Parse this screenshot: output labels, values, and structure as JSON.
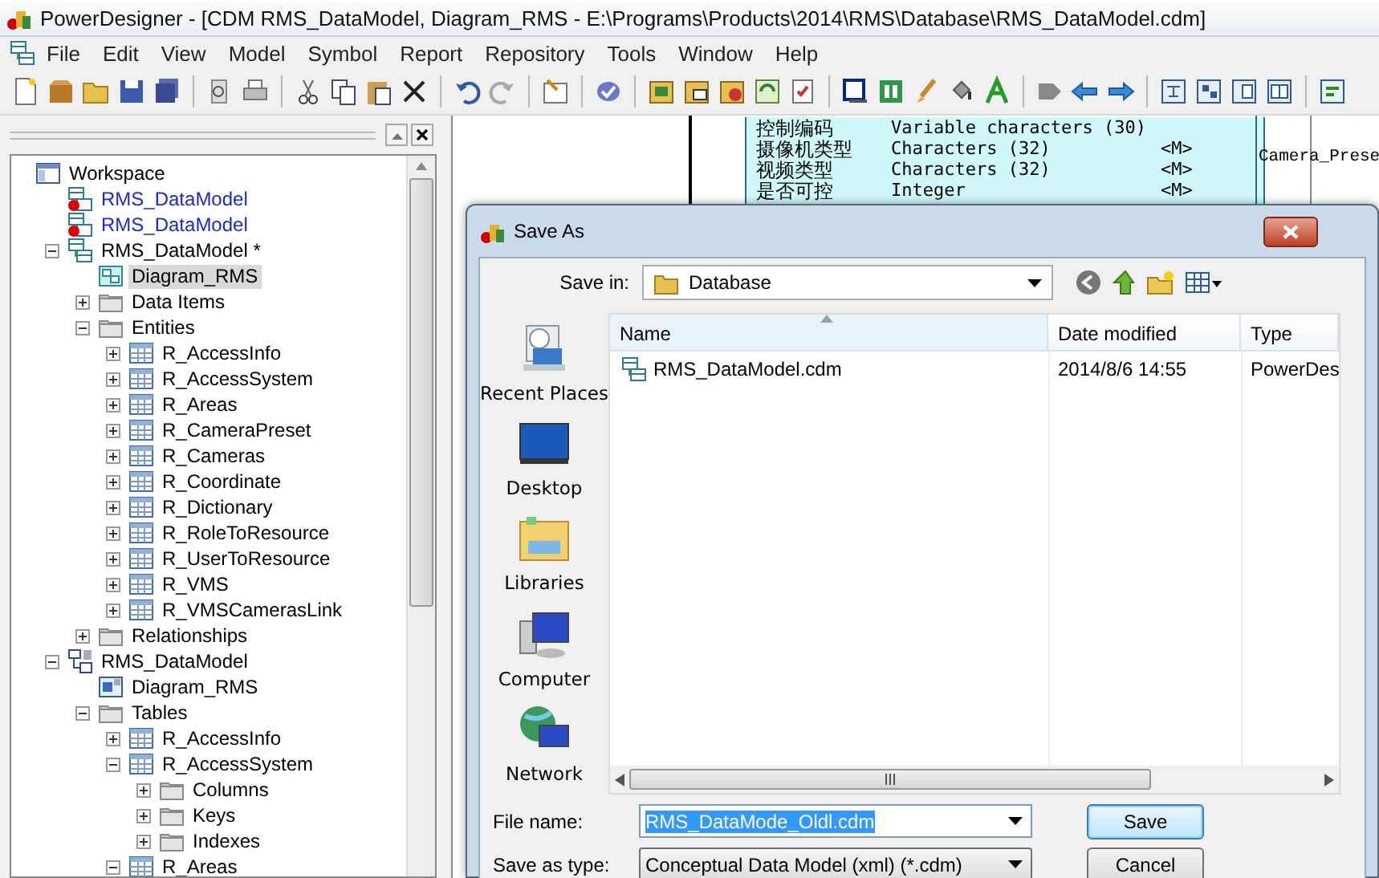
{
  "window": {
    "title": "PowerDesigner - [CDM RMS_DataModel, Diagram_RMS - E:\\Programs\\Products\\2014\\RMS\\Database\\RMS_DataModel.cdm]"
  },
  "menu": [
    "File",
    "Edit",
    "View",
    "Model",
    "Symbol",
    "Report",
    "Repository",
    "Tools",
    "Window",
    "Help"
  ],
  "browser": {
    "tree": [
      {
        "label": "Workspace",
        "kind": "workspace",
        "selected": false,
        "children": [
          {
            "label": "RMS_DataModel",
            "kind": "model-closed",
            "selected": false
          },
          {
            "label": "RMS_DataModel",
            "kind": "model-closed",
            "selected": false
          },
          {
            "label": "RMS_DataModel *",
            "kind": "model",
            "expanded": true,
            "selected": false,
            "children": [
              {
                "label": "Diagram_RMS",
                "kind": "diagram",
                "selected": true
              },
              {
                "label": "Data Items",
                "kind": "folder",
                "expanded": false,
                "selected": false
              },
              {
                "label": "Entities",
                "kind": "folder",
                "expanded": true,
                "selected": false,
                "children": [
                  {
                    "label": "R_AccessInfo",
                    "kind": "table",
                    "expanded": false,
                    "selected": false
                  },
                  {
                    "label": "R_AccessSystem",
                    "kind": "table",
                    "expanded": false,
                    "selected": false
                  },
                  {
                    "label": "R_Areas",
                    "kind": "table",
                    "expanded": false,
                    "selected": false
                  },
                  {
                    "label": "R_CameraPreset",
                    "kind": "table",
                    "expanded": false,
                    "selected": false
                  },
                  {
                    "label": "R_Cameras",
                    "kind": "table",
                    "expanded": false,
                    "selected": false
                  },
                  {
                    "label": "R_Coordinate",
                    "kind": "table",
                    "expanded": false,
                    "selected": false
                  },
                  {
                    "label": "R_Dictionary",
                    "kind": "table",
                    "expanded": false,
                    "selected": false
                  },
                  {
                    "label": "R_RoleToResource",
                    "kind": "table",
                    "expanded": false,
                    "selected": false
                  },
                  {
                    "label": "R_UserToResource",
                    "kind": "table",
                    "expanded": false,
                    "selected": false
                  },
                  {
                    "label": "R_VMS",
                    "kind": "table",
                    "expanded": false,
                    "selected": false
                  },
                  {
                    "label": "R_VMSCamerasLink",
                    "kind": "table",
                    "expanded": false,
                    "selected": false
                  }
                ]
              },
              {
                "label": "Relationships",
                "kind": "folder",
                "expanded": false,
                "selected": false
              }
            ]
          },
          {
            "label": "RMS_DataModel",
            "kind": "pdm",
            "expanded": true,
            "selected": false,
            "children": [
              {
                "label": "Diagram_RMS",
                "kind": "pdm-diagram",
                "selected": false
              },
              {
                "label": "Tables",
                "kind": "folder",
                "expanded": true,
                "selected": false,
                "children": [
                  {
                    "label": "R_AccessInfo",
                    "kind": "table",
                    "expanded": false,
                    "selected": false
                  },
                  {
                    "label": "R_AccessSystem",
                    "kind": "table",
                    "expanded": true,
                    "selected": false,
                    "children": [
                      {
                        "label": "Columns",
                        "kind": "folder",
                        "expanded": false,
                        "selected": false
                      },
                      {
                        "label": "Keys",
                        "kind": "folder",
                        "expanded": false,
                        "selected": false
                      },
                      {
                        "label": "Indexes",
                        "kind": "folder",
                        "expanded": false,
                        "selected": false
                      }
                    ]
                  },
                  {
                    "label": "R_Areas",
                    "kind": "table",
                    "expanded": true,
                    "selected": false
                  }
                ]
              }
            ]
          }
        ]
      }
    ]
  },
  "diagram": {
    "entity_rows": [
      {
        "name": "控制编码",
        "type": "Variable characters (30)"
      },
      {
        "name": "摄像机类型",
        "type": "Characters (32)",
        "marker": "<M>"
      },
      {
        "name": "视频类型",
        "type": "Characters (32)",
        "marker": "<M>"
      },
      {
        "name": "是否可控",
        "type": "Integer",
        "marker": "<M>"
      }
    ],
    "label": "Camera_Prese"
  },
  "dialog": {
    "title": "Save As",
    "save_in_label": "Save in:",
    "save_in": "Database",
    "places": [
      {
        "label": "Recent Places",
        "kind": "recent"
      },
      {
        "label": "Desktop",
        "kind": "desktop"
      },
      {
        "label": "Libraries",
        "kind": "libraries"
      },
      {
        "label": "Computer",
        "kind": "computer"
      },
      {
        "label": "Network",
        "kind": "network"
      }
    ],
    "columns": [
      "Name",
      "Date modified",
      "Type"
    ],
    "files": [
      {
        "name": "RMS_DataModel.cdm",
        "date": "2014/8/6 14:55",
        "type": "PowerDes"
      }
    ],
    "file_name_label": "File name:",
    "file_name": {
      "value": "RMS_DataMode_Oldl.cdm",
      "text_selected": true
    },
    "save_type_label": "Save as type:",
    "save_type": "Conceptual Data Model (xml) (*.cdm)",
    "buttons": [
      {
        "label": "Save",
        "default": true
      },
      {
        "label": "Cancel",
        "default": false
      }
    ]
  }
}
